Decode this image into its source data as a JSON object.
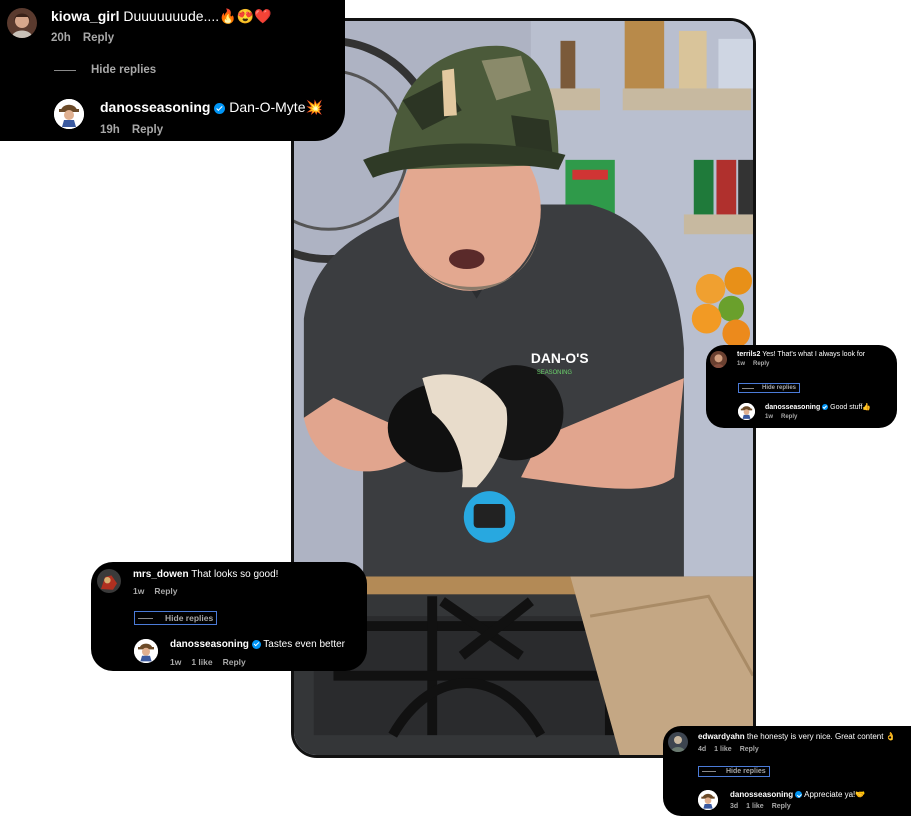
{
  "comments": [
    {
      "user": "kiowa_girl",
      "text": "Duuuuuuude....🔥😍❤️",
      "time": "20h",
      "reply_label": "Reply",
      "hide_replies_label": "Hide replies",
      "reply": {
        "user": "danosseasoning",
        "verified": true,
        "text": "Dan-O-Myte💥",
        "time": "19h",
        "reply_label": "Reply"
      }
    },
    {
      "user": "terrils2",
      "text": "Yes! That's what I always look for",
      "time": "1w",
      "reply_label": "Reply",
      "hide_replies_label": "Hide replies",
      "reply": {
        "user": "danosseasoning",
        "verified": true,
        "text": "Good stuff👍",
        "time": "1w",
        "reply_label": "Reply"
      }
    },
    {
      "user": "mrs_dowen",
      "text": "That looks so good!",
      "time": "1w",
      "reply_label": "Reply",
      "hide_replies_label": "Hide replies",
      "reply": {
        "user": "danosseasoning",
        "verified": true,
        "text": "Tastes even better",
        "time": "1w",
        "likes": "1 like",
        "reply_label": "Reply"
      }
    },
    {
      "user": "edwardyahn",
      "text": "the honesty is very nice. Great content 👌",
      "time": "4d",
      "likes": "1 like",
      "reply_label": "Reply",
      "hide_replies_label": "Hide replies",
      "reply": {
        "user": "danosseasoning",
        "verified": true,
        "text": "Appreciate ya!🤝",
        "time": "3d",
        "likes": "1 like",
        "reply_label": "Reply"
      }
    }
  ],
  "video": {
    "shirt_logo": "DAN-O'S",
    "shirt_sub": "SEASONING"
  },
  "colors": {
    "card_bg": "#000000",
    "meta_text": "#a8a8a8",
    "verified_blue": "#0095f6",
    "hide_box": "#4b7bd8"
  }
}
